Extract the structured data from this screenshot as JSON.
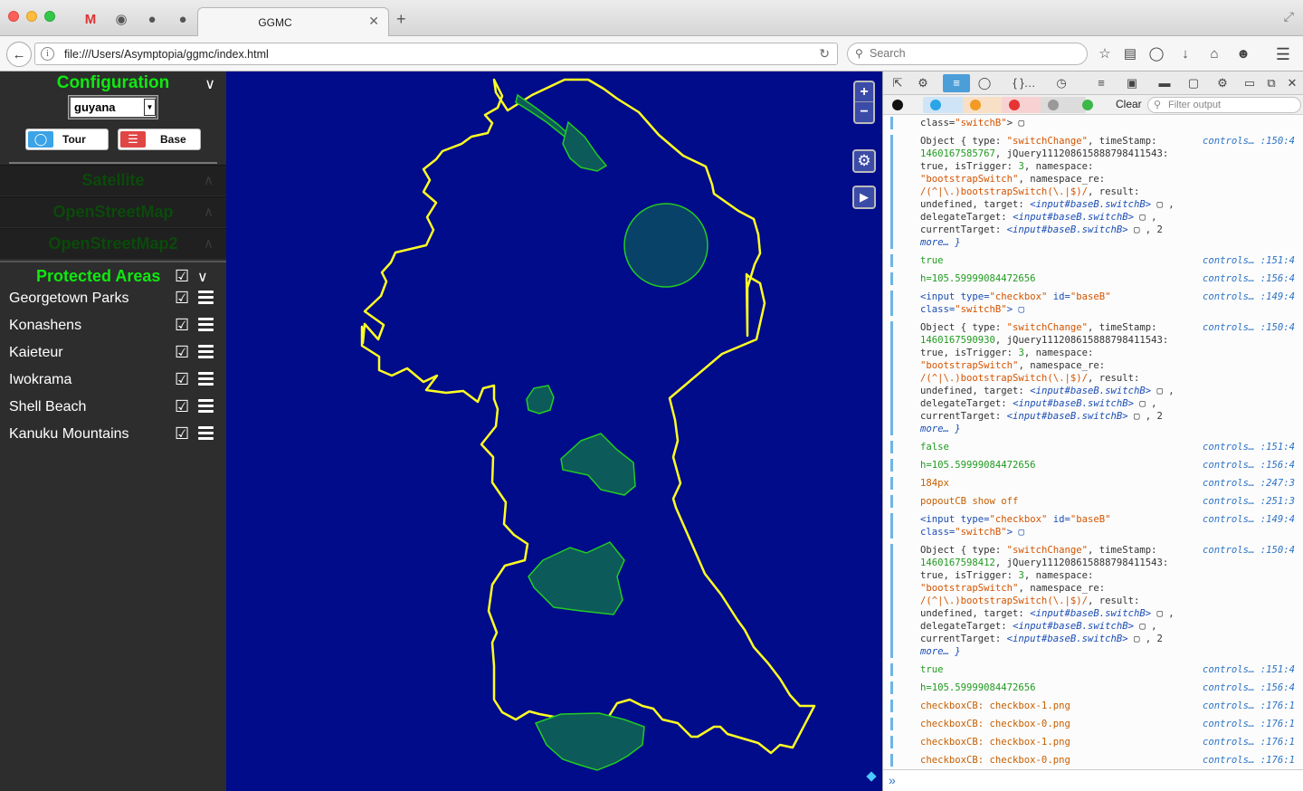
{
  "browser": {
    "tab_title": "GGMC",
    "url": "file:///Users/Asymptopia/ggmc/index.html",
    "search_placeholder": "Search"
  },
  "sidebar": {
    "config_title": "Configuration",
    "region": "guyana",
    "tour_label": "Tour",
    "base_label": "Base",
    "layers": [
      "Satellite",
      "OpenStreetMap",
      "OpenStreetMap2"
    ],
    "pa_title": "Protected Areas",
    "protected_areas": [
      "Georgetown Parks",
      "Konashens",
      "Kaieteur",
      "Iwokrama",
      "Shell Beach",
      "Kanuku Mountains"
    ]
  },
  "map": {
    "zoom_in": "+",
    "zoom_out": "−",
    "colors": {
      "background": "#000c8a",
      "boundary": "#ffff22",
      "area_fill": "#0d5a5a",
      "area_stroke": "#22cc22"
    }
  },
  "devtools": {
    "clear_label": "Clear",
    "filter_placeholder": "Filter output",
    "header_tail": "class=\"switchB\">",
    "log": [
      {
        "kind": "obj",
        "ts": "1460167585767",
        "src": "controls… :150:4"
      },
      {
        "kind": "plain",
        "text": "true",
        "cls": "c-green",
        "src": "controls… :151:4"
      },
      {
        "kind": "plain",
        "text": "h=105.59999084472656",
        "cls": "c-green",
        "src": "controls… :156:4"
      },
      {
        "kind": "input",
        "src": "controls… :149:4"
      },
      {
        "kind": "obj",
        "ts": "1460167590930",
        "src": "controls… :150:4"
      },
      {
        "kind": "plain",
        "text": "false",
        "cls": "c-green",
        "src": "controls… :151:4"
      },
      {
        "kind": "plain",
        "text": "h=105.59999084472656",
        "cls": "c-green",
        "src": "controls… :156:4"
      },
      {
        "kind": "plain",
        "text": "184px",
        "cls": "c-orange",
        "src": "controls… :247:3"
      },
      {
        "kind": "plain",
        "text": "popoutCB show off",
        "cls": "c-orange",
        "src": "controls… :251:3"
      },
      {
        "kind": "input",
        "src": "controls… :149:4"
      },
      {
        "kind": "obj",
        "ts": "1460167598412",
        "src": "controls… :150:4"
      },
      {
        "kind": "plain",
        "text": "true",
        "cls": "c-green",
        "src": "controls… :151:4"
      },
      {
        "kind": "plain",
        "text": "h=105.59999084472656",
        "cls": "c-green",
        "src": "controls… :156:4"
      },
      {
        "kind": "plain",
        "text": "checkboxCB: checkbox-1.png",
        "cls": "c-orange",
        "src": "controls… :176:1"
      },
      {
        "kind": "plain",
        "text": "checkboxCB: checkbox-0.png",
        "cls": "c-orange",
        "src": "controls… :176:1"
      },
      {
        "kind": "plain",
        "text": "checkboxCB: checkbox-1.png",
        "cls": "c-orange",
        "src": "controls… :176:1"
      },
      {
        "kind": "plain",
        "text": "checkboxCB: checkbox-0.png",
        "cls": "c-orange",
        "src": "controls… :176:1"
      }
    ],
    "obj_lines": {
      "l1": "Object { type: ",
      "type": "\"switchChange\"",
      "l1b": ", timeStamp:",
      "jq": ", jQuery111208615888798411543:",
      "l3a": "true",
      "l3b": ", isTrigger: ",
      "l3c": "3",
      "l3d": ", namespace:",
      "l4a": "\"bootstrapSwitch\"",
      "l4b": ", namespace_re:",
      "l5a": "/(^|\\.)bootstrapSwitch(\\.|$)/",
      "l5b": ", result:",
      "l6a": "undefined, target: ",
      "l6b": "<input#baseB.switchB>",
      "l7a": "delegateTarget: ",
      "l8a": "currentTarget: ",
      "l8c": ", 2",
      "l9": "more… }"
    },
    "input_lines": {
      "a": "<input ",
      "b": "type=",
      "c": "\"checkbox\"",
      "d": " id=",
      "e": "\"baseB\"",
      "f": "class=",
      "g": "\"switchB\"",
      "h": ">"
    }
  }
}
